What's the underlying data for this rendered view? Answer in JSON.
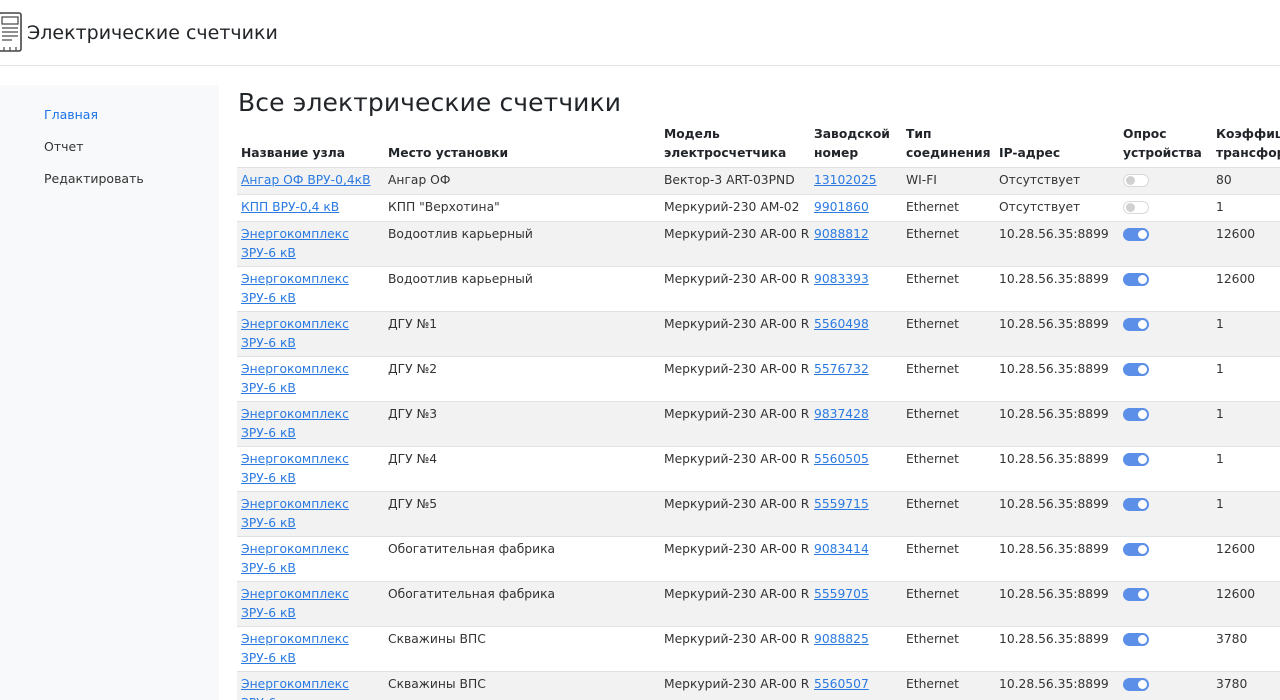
{
  "app": {
    "title": "Электрические счетчики"
  },
  "sidebar": {
    "items": [
      {
        "label": "Главная",
        "active": true
      },
      {
        "label": "Отчет",
        "active": false
      },
      {
        "label": "Редактировать",
        "active": false
      }
    ]
  },
  "main": {
    "title": "Все электрические счетчики"
  },
  "table": {
    "headers": {
      "node": "Название узла",
      "location": "Место установки",
      "model_1": "Модель",
      "model_2": "электросчетчика",
      "serial_1": "Заводской",
      "serial_2": "номер",
      "conn_1": "Тип",
      "conn_2": "соединения",
      "ip": "IP-адрес",
      "poll_1": "Опрос",
      "poll_2": "устройства",
      "coef_1": "Коэффициент",
      "coef_2": "трансформации"
    },
    "rows": [
      {
        "node": "Ангар ОФ ВРУ-0,4кВ",
        "location": "Ангар ОФ",
        "model": "Вектор-3 ART-03PND",
        "serial": "13102025",
        "connection": "WI-FI",
        "ip": "Отсутствует",
        "polling": false,
        "coef": "80"
      },
      {
        "node": "КПП ВРУ-0,4 кВ",
        "location": "КПП \"Верхотина\"",
        "model": "Меркурий-230 AM-02",
        "serial": "9901860",
        "connection": "Ethernet",
        "ip": "Отсутствует",
        "polling": false,
        "coef": "1"
      },
      {
        "node": "Энергокомплекс ЗРУ-6 кВ",
        "location": "Водоотлив карьерный",
        "model": "Меркурий-230 AR-00 R",
        "serial": "9088812",
        "connection": "Ethernet",
        "ip": "10.28.56.35:8899",
        "polling": true,
        "coef": "12600"
      },
      {
        "node": "Энергокомплекс ЗРУ-6 кВ",
        "location": "Водоотлив карьерный",
        "model": "Меркурий-230 AR-00 R",
        "serial": "9083393",
        "connection": "Ethernet",
        "ip": "10.28.56.35:8899",
        "polling": true,
        "coef": "12600"
      },
      {
        "node": "Энергокомплекс ЗРУ-6 кВ",
        "location": "ДГУ №1",
        "model": "Меркурий-230 AR-00 R",
        "serial": "5560498",
        "connection": "Ethernet",
        "ip": "10.28.56.35:8899",
        "polling": true,
        "coef": "1"
      },
      {
        "node": "Энергокомплекс ЗРУ-6 кВ",
        "location": "ДГУ №2",
        "model": "Меркурий-230 AR-00 R",
        "serial": "5576732",
        "connection": "Ethernet",
        "ip": "10.28.56.35:8899",
        "polling": true,
        "coef": "1"
      },
      {
        "node": "Энергокомплекс ЗРУ-6 кВ",
        "location": "ДГУ №3",
        "model": "Меркурий-230 AR-00 R",
        "serial": "9837428",
        "connection": "Ethernet",
        "ip": "10.28.56.35:8899",
        "polling": true,
        "coef": "1"
      },
      {
        "node": "Энергокомплекс ЗРУ-6 кВ",
        "location": "ДГУ №4",
        "model": "Меркурий-230 AR-00 R",
        "serial": "5560505",
        "connection": "Ethernet",
        "ip": "10.28.56.35:8899",
        "polling": true,
        "coef": "1"
      },
      {
        "node": "Энергокомплекс ЗРУ-6 кВ",
        "location": "ДГУ №5",
        "model": "Меркурий-230 AR-00 R",
        "serial": "5559715",
        "connection": "Ethernet",
        "ip": "10.28.56.35:8899",
        "polling": true,
        "coef": "1"
      },
      {
        "node": "Энергокомплекс ЗРУ-6 кВ",
        "location": "Обогатительная фабрика",
        "model": "Меркурий-230 AR-00 R",
        "serial": "9083414",
        "connection": "Ethernet",
        "ip": "10.28.56.35:8899",
        "polling": true,
        "coef": "12600"
      },
      {
        "node": "Энергокомплекс ЗРУ-6 кВ",
        "location": "Обогатительная фабрика",
        "model": "Меркурий-230 AR-00 R",
        "serial": "5559705",
        "connection": "Ethernet",
        "ip": "10.28.56.35:8899",
        "polling": true,
        "coef": "12600"
      },
      {
        "node": "Энергокомплекс ЗРУ-6 кВ",
        "location": "Скважины ВПС",
        "model": "Меркурий-230 AR-00 R",
        "serial": "9088825",
        "connection": "Ethernet",
        "ip": "10.28.56.35:8899",
        "polling": true,
        "coef": "3780"
      },
      {
        "node": "Энергокомплекс ЗРУ-6",
        "location": "Скважины ВПС",
        "model": "Меркурий-230 AR-00 R",
        "serial": "5560507",
        "connection": "Ethernet",
        "ip": "10.28.56.35:8899",
        "polling": true,
        "coef": "3780"
      }
    ]
  },
  "colors": {
    "link": "#2a7ae2",
    "toggle_on": "#5b8fe8",
    "row_stripe": "#f2f2f2",
    "sidebar_bg": "#f8f9fa"
  }
}
